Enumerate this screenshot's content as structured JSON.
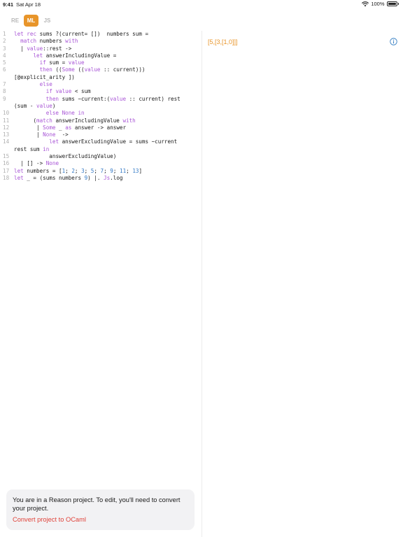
{
  "status_bar": {
    "time": "9:41",
    "date": "Sat Apr 18",
    "battery": "100%"
  },
  "tabs": [
    {
      "label": "RE",
      "active": false
    },
    {
      "label": "ML",
      "active": true
    },
    {
      "label": "JS",
      "active": false
    }
  ],
  "editor": {
    "line_numbers": [
      "1",
      "2",
      "3",
      "4",
      "5",
      "6",
      "",
      "7",
      "8",
      "9",
      "",
      "10",
      "11",
      "12",
      "13",
      "14",
      "",
      "15",
      "16",
      "17",
      "18"
    ],
    "code_lines": [
      "let rec sums ?(current= [])  numbers sum =",
      "  match numbers with",
      "  | value::rest ->",
      "      let answerIncludingValue =",
      "        if sum = value",
      "        then ((Some ((value :: current)))",
      "[@explicit_arity ])",
      "        else",
      "          if value < sum",
      "          then sums ~current:(value :: current) rest",
      "(sum - value)",
      "          else None in",
      "      (match answerIncludingValue with",
      "       | Some _ as answer -> answer",
      "       | None  ->",
      "           let answerExcludingValue = sums ~current",
      "rest sum in",
      "           answerExcludingValue)",
      "  | [] -> None",
      "let numbers = [1; 2; 3; 5; 7; 9; 11; 13]",
      "let _ = (sums numbers 9) |. Js.log"
    ]
  },
  "output": {
    "text": "[5,[3,[1,0]]]"
  },
  "info_icon": "info-circle-icon",
  "toast": {
    "message": "You are in a Reason project. To edit, you'll need to convert your project.",
    "action_label": "Convert project to OCaml"
  },
  "colors": {
    "accent": "#e8952a",
    "keyword": "#a855d6",
    "number": "#3178c6",
    "link": "#e0433a",
    "info": "#3b82c4"
  }
}
